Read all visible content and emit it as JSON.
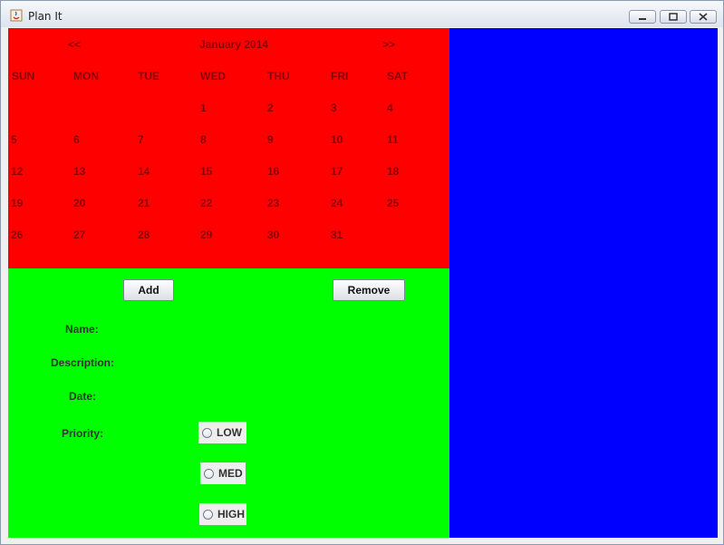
{
  "window": {
    "title": "Plan It"
  },
  "calendar": {
    "prev_label": "<<",
    "next_label": ">>",
    "month_label": "January 2014",
    "weekdays": [
      "SUN",
      "MON",
      "TUE",
      "WED",
      "THU",
      "FRI",
      "SAT"
    ],
    "weeks": [
      [
        "",
        "",
        "",
        "1",
        "2",
        "3",
        "4"
      ],
      [
        "5",
        "6",
        "7",
        "8",
        "9",
        "10",
        "11"
      ],
      [
        "12",
        "13",
        "14",
        "15",
        "16",
        "17",
        "18"
      ],
      [
        "19",
        "20",
        "21",
        "22",
        "23",
        "24",
        "25"
      ],
      [
        "26",
        "27",
        "28",
        "29",
        "30",
        "31",
        ""
      ]
    ]
  },
  "form": {
    "add_label": "Add",
    "remove_label": "Remove",
    "name_label": "Name:",
    "description_label": "Description:",
    "date_label": "Date:",
    "priority_label": "Priority:",
    "priority_options": [
      "LOW",
      "MED",
      "HIGH"
    ]
  },
  "colors": {
    "calendar_bg": "#ff0000",
    "form_bg": "#00ff00",
    "side_bg": "#0000ff"
  }
}
